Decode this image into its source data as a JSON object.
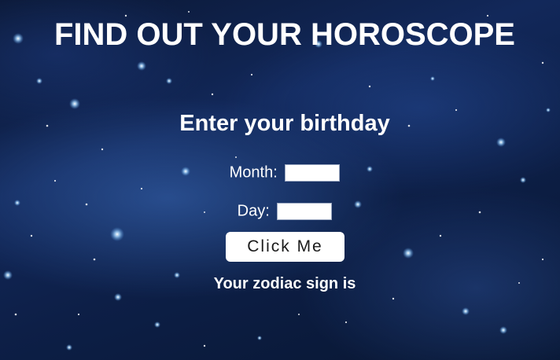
{
  "page": {
    "title": "FIND OUT YOUR HOROSCOPE",
    "subtitle": "Enter your birthday"
  },
  "form": {
    "month_label": "Month:",
    "month_value": "",
    "day_label": "Day:",
    "day_value": "",
    "button_label": "Click Me"
  },
  "result": {
    "text": "Your zodiac sign is"
  },
  "theme": {
    "background": "starry-night-sky",
    "text_color": "#ffffff",
    "button_color": "#ffffff"
  }
}
